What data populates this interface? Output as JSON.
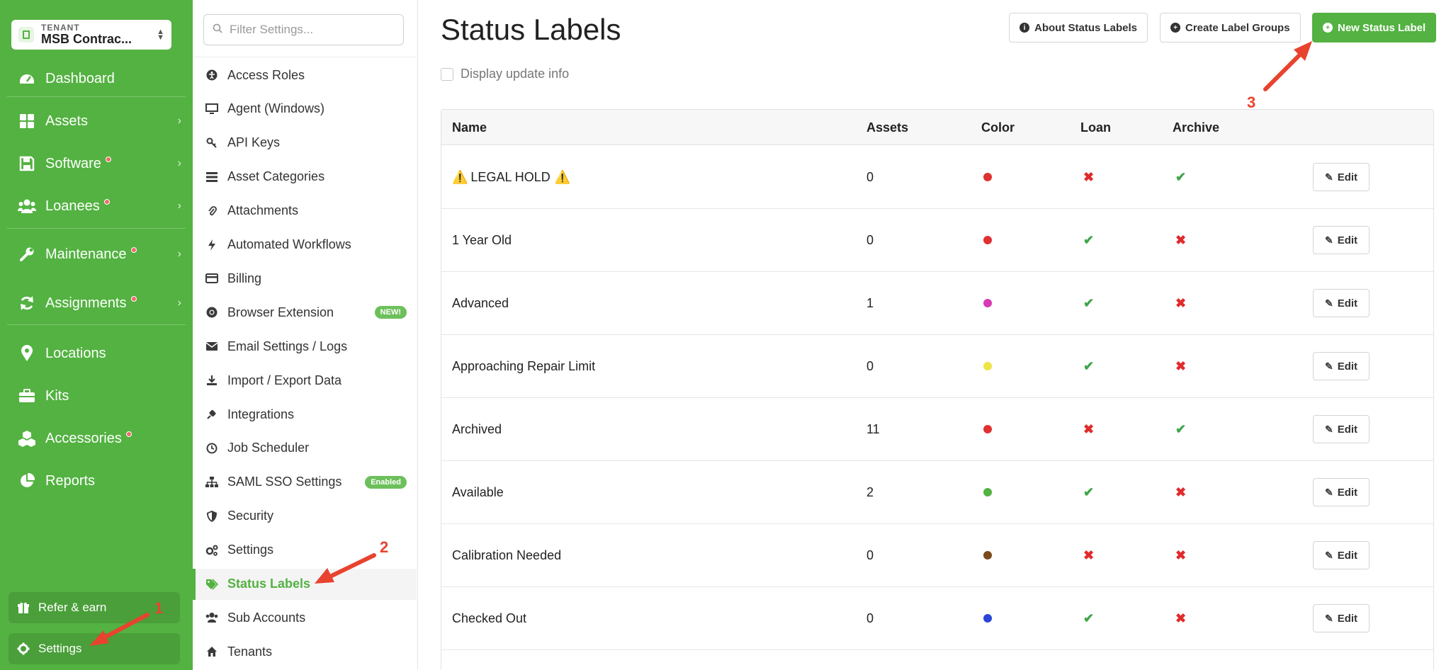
{
  "tenant": {
    "caption": "TENANT",
    "name": "MSB Contrac..."
  },
  "nav": [
    {
      "id": "dashboard",
      "label": "Dashboard",
      "icon": "dashboard-icon",
      "dot": false,
      "chevron": false
    },
    {
      "id": "assets",
      "label": "Assets",
      "icon": "grid-icon",
      "dot": false,
      "chevron": true
    },
    {
      "id": "software",
      "label": "Software",
      "icon": "floppy-icon",
      "dot": true,
      "chevron": true
    },
    {
      "id": "loanees",
      "label": "Loanees",
      "icon": "users-icon",
      "dot": true,
      "chevron": true
    },
    {
      "id": "maintenance",
      "label": "Maintenance",
      "icon": "wrench-icon",
      "dot": true,
      "chevron": true
    },
    {
      "id": "assignments",
      "label": "Assignments",
      "icon": "sync-icon",
      "dot": true,
      "chevron": true
    },
    {
      "id": "locations",
      "label": "Locations",
      "icon": "map-pin-icon",
      "dot": false,
      "chevron": false
    },
    {
      "id": "kits",
      "label": "Kits",
      "icon": "briefcase-icon",
      "dot": false,
      "chevron": false
    },
    {
      "id": "accessories",
      "label": "Accessories",
      "icon": "cubes-icon",
      "dot": true,
      "chevron": false
    },
    {
      "id": "reports",
      "label": "Reports",
      "icon": "pie-chart-icon",
      "dot": false,
      "chevron": false
    }
  ],
  "bottom": {
    "refer": "Refer & earn",
    "settings": "Settings"
  },
  "filter": {
    "placeholder": "Filter Settings..."
  },
  "submenu": [
    {
      "label": "Access Roles",
      "icon": "universal-access-icon"
    },
    {
      "label": "Agent (Windows)",
      "icon": "monitor-icon"
    },
    {
      "label": "API Keys",
      "icon": "key-icon"
    },
    {
      "label": "Asset Categories",
      "icon": "list-icon"
    },
    {
      "label": "Attachments",
      "icon": "paperclip-icon"
    },
    {
      "label": "Automated Workflows",
      "icon": "bolt-icon"
    },
    {
      "label": "Billing",
      "icon": "credit-card-icon"
    },
    {
      "label": "Browser Extension",
      "icon": "chrome-icon",
      "badge": "NEW!"
    },
    {
      "label": "Email Settings / Logs",
      "icon": "envelope-icon"
    },
    {
      "label": "Import / Export Data",
      "icon": "download-icon"
    },
    {
      "label": "Integrations",
      "icon": "plug-icon"
    },
    {
      "label": "Job Scheduler",
      "icon": "clock-icon"
    },
    {
      "label": "SAML SSO Settings",
      "icon": "sitemap-icon",
      "badge": "Enabled"
    },
    {
      "label": "Security",
      "icon": "shield-icon"
    },
    {
      "label": "Settings",
      "icon": "cogs-icon"
    },
    {
      "label": "Status Labels",
      "icon": "tags-icon",
      "active": true
    },
    {
      "label": "Sub Accounts",
      "icon": "users-icon"
    },
    {
      "label": "Tenants",
      "icon": "home-icon"
    }
  ],
  "page": {
    "title": "Status Labels",
    "about_button": "About Status Labels",
    "groups_button": "Create Label Groups",
    "new_button": "New Status Label",
    "display_update_info": "Display update info"
  },
  "table": {
    "headers": {
      "name": "Name",
      "assets": "Assets",
      "color": "Color",
      "loan": "Loan",
      "archive": "Archive"
    },
    "edit_label": "Edit",
    "rows": [
      {
        "name": "LEGAL HOLD",
        "warning": true,
        "assets": "0",
        "color": "#e03131",
        "loan": false,
        "archive": true
      },
      {
        "name": "1 Year Old",
        "warning": false,
        "assets": "0",
        "color": "#e03131",
        "loan": true,
        "archive": false
      },
      {
        "name": "Advanced",
        "warning": false,
        "assets": "1",
        "color": "#d63bb4",
        "loan": true,
        "archive": false
      },
      {
        "name": "Approaching Repair Limit",
        "warning": false,
        "assets": "0",
        "color": "#ede544",
        "loan": true,
        "archive": false
      },
      {
        "name": "Archived",
        "warning": false,
        "assets": "11",
        "color": "#e03131",
        "loan": false,
        "archive": true
      },
      {
        "name": "Available",
        "warning": false,
        "assets": "2",
        "color": "#53b241",
        "loan": true,
        "archive": false
      },
      {
        "name": "Calibration Needed",
        "warning": false,
        "assets": "0",
        "color": "#7a4a1e",
        "loan": false,
        "archive": false
      },
      {
        "name": "Checked Out",
        "warning": false,
        "assets": "0",
        "color": "#2b45d8",
        "loan": true,
        "archive": false
      }
    ]
  },
  "annotations": {
    "one": "1",
    "two": "2",
    "three": "3"
  },
  "colors": {
    "brand": "#53b241",
    "annotation": "#e8432e",
    "check": "#3fa54a",
    "cross": "#e02b2b"
  }
}
